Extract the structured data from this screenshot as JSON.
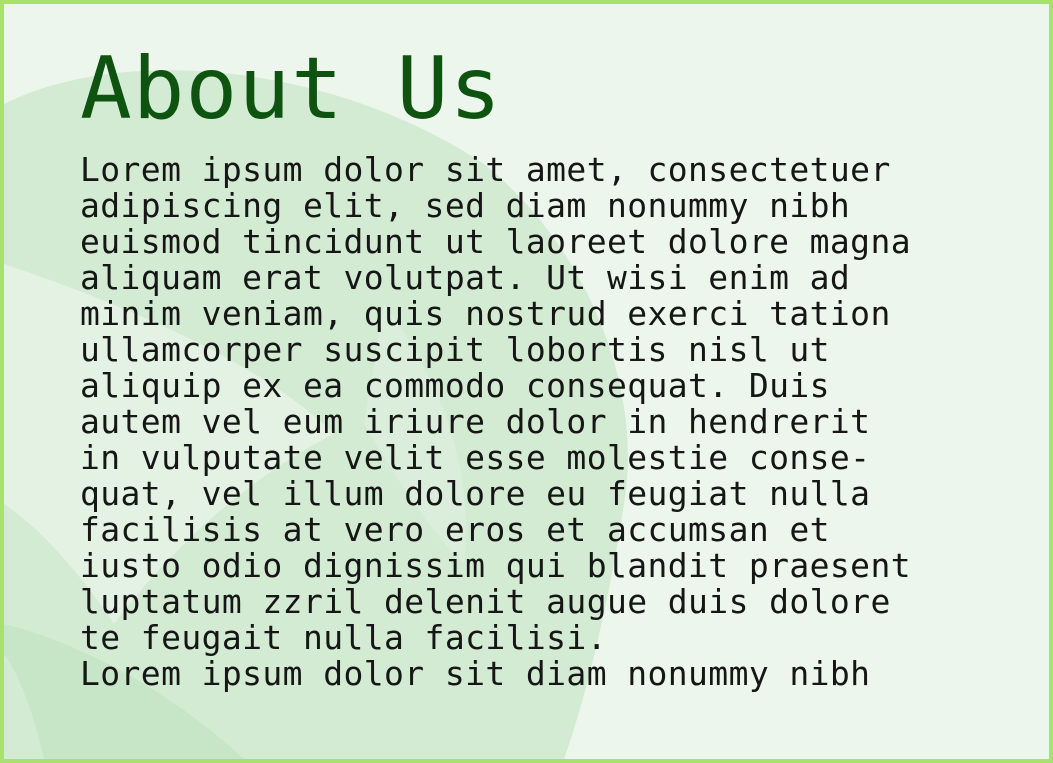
{
  "page": {
    "title": "About Us",
    "body_lines": [
      "Lorem ipsum dolor sit amet, consectetuer",
      "adipiscing elit, sed diam nonummy nibh",
      "euismod tincidunt ut laoreet dolore magna",
      "aliquam erat volutpat. Ut wisi enim ad",
      "minim veniam, quis nostrud exerci tation",
      "ullamcorper suscipit lobortis nisl ut",
      "aliquip ex ea commodo consequat. Duis",
      "autem vel eum iriure dolor in hendrerit",
      "in vulputate velit esse molestie conse-",
      "quat, vel illum dolore eu feugiat nulla",
      "facilisis at vero eros et accumsan et",
      "iusto odio dignissim qui blandit praesent",
      "luptatum zzril delenit augue duis dolore",
      "te feugait nulla facilisi.",
      "Lorem ipsum dolor sit diam nonummy nibh"
    ]
  },
  "colors": {
    "border": "#a9e16d",
    "background": "#edf6ec",
    "title": "#0e5410",
    "text": "#161616",
    "decoration": "#cfe8cf"
  }
}
